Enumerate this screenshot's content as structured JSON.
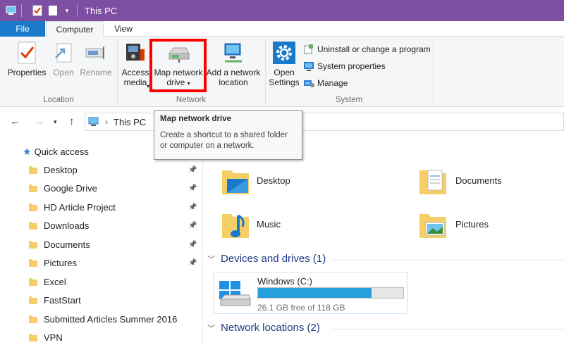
{
  "titlebar": {
    "title": "This PC"
  },
  "tabs": {
    "file": "File",
    "computer": "Computer",
    "view": "View"
  },
  "ribbon": {
    "properties": "Properties",
    "open": "Open",
    "rename": "Rename",
    "access_media_1": "Access",
    "access_media_2": "media",
    "map_drive_1": "Map network",
    "map_drive_2": "drive",
    "add_network_1": "Add a network",
    "add_network_2": "location",
    "open_settings_1": "Open",
    "open_settings_2": "Settings",
    "uninstall": "Uninstall or change a program",
    "system_properties": "System properties",
    "manage": "Manage",
    "group_location": "Location",
    "group_network": "Network",
    "group_system": "System"
  },
  "address": {
    "path": "This PC"
  },
  "tooltip": {
    "title": "Map network drive",
    "body_1": "Create a shortcut to a shared folder",
    "body_2": "or computer on a network."
  },
  "sidebar": {
    "quick_access": "Quick access",
    "items": [
      {
        "label": "Desktop"
      },
      {
        "label": "Google Drive"
      },
      {
        "label": "HD Article Project"
      },
      {
        "label": "Downloads"
      },
      {
        "label": "Documents"
      },
      {
        "label": "Pictures"
      },
      {
        "label": "Excel"
      },
      {
        "label": "FastStart"
      },
      {
        "label": "Submitted Articles Summer 2016"
      },
      {
        "label": "VPN"
      }
    ]
  },
  "main": {
    "folders": {
      "desktop": "Desktop",
      "documents": "Documents",
      "music": "Music",
      "pictures": "Pictures"
    },
    "devices_header": "Devices and drives (1)",
    "drive": {
      "name": "Windows (C:)",
      "free": "26.1 GB free of 118 GB",
      "used_fraction": 0.78
    },
    "network_header": "Network locations (2)"
  },
  "colors": {
    "title_bar": "#7e4ea3",
    "file_tab": "#1979ca",
    "highlight": "#ff0000",
    "drive_fill": "#26a0da"
  }
}
